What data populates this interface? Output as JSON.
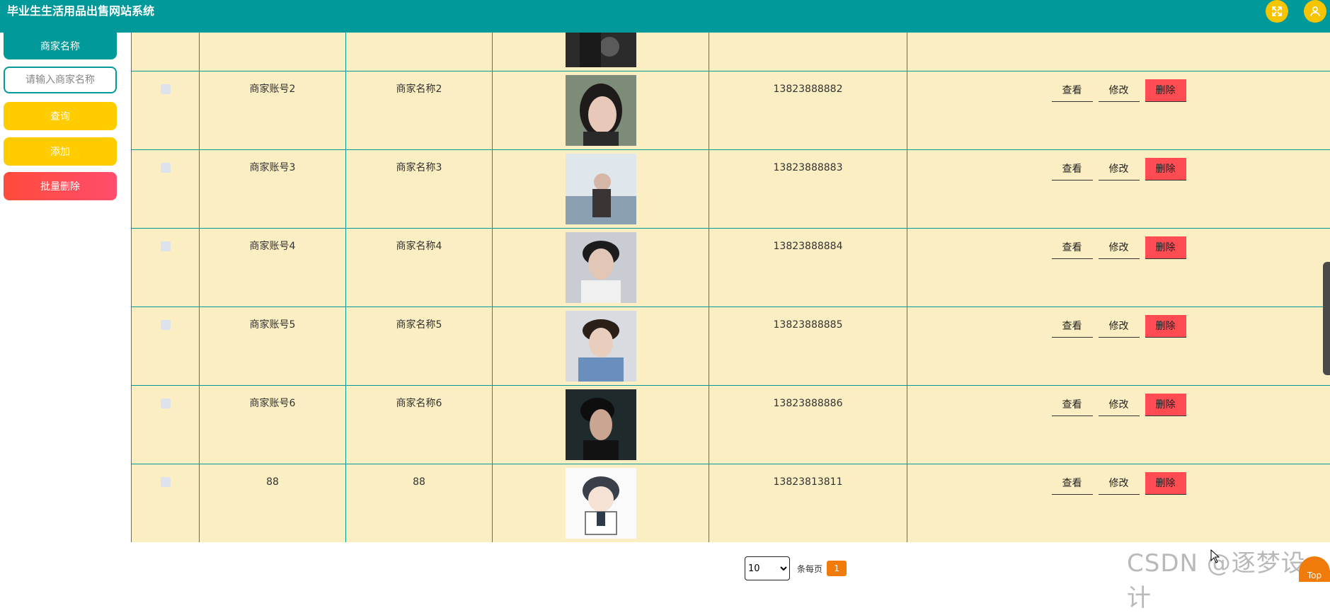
{
  "app": {
    "title": "毕业生生活用品出售网站系统"
  },
  "sidebar": {
    "search_label": "商家名称",
    "search_placeholder": "请输入商家名称",
    "query_button": "查询",
    "add_button": "添加",
    "batch_delete_button": "批量删除"
  },
  "table": {
    "rows": [
      {
        "account": "",
        "name": "",
        "phone": "",
        "partial": true
      },
      {
        "account": "商家账号2",
        "name": "商家名称2",
        "phone": "13823888882"
      },
      {
        "account": "商家账号3",
        "name": "商家名称3",
        "phone": "13823888883"
      },
      {
        "account": "商家账号4",
        "name": "商家名称4",
        "phone": "13823888884"
      },
      {
        "account": "商家账号5",
        "name": "商家名称5",
        "phone": "13823888885"
      },
      {
        "account": "商家账号6",
        "name": "商家名称6",
        "phone": "13823888886"
      },
      {
        "account": "88",
        "name": "88",
        "phone": "13823813811"
      }
    ],
    "actions": {
      "view": "查看",
      "edit": "修改",
      "delete": "删除"
    }
  },
  "pagination": {
    "page_size": "10",
    "page_size_options": [
      "10"
    ],
    "per_page_label": "条每页",
    "current_page": "1"
  },
  "watermark": "CSDN @逐梦设计",
  "back_to_top": "Top",
  "colors": {
    "primary": "#02999a",
    "accent_yellow": "#ffcc00",
    "danger": "#ff4b52",
    "row_bg": "#fbeec2",
    "page_active": "#f07b0a"
  }
}
